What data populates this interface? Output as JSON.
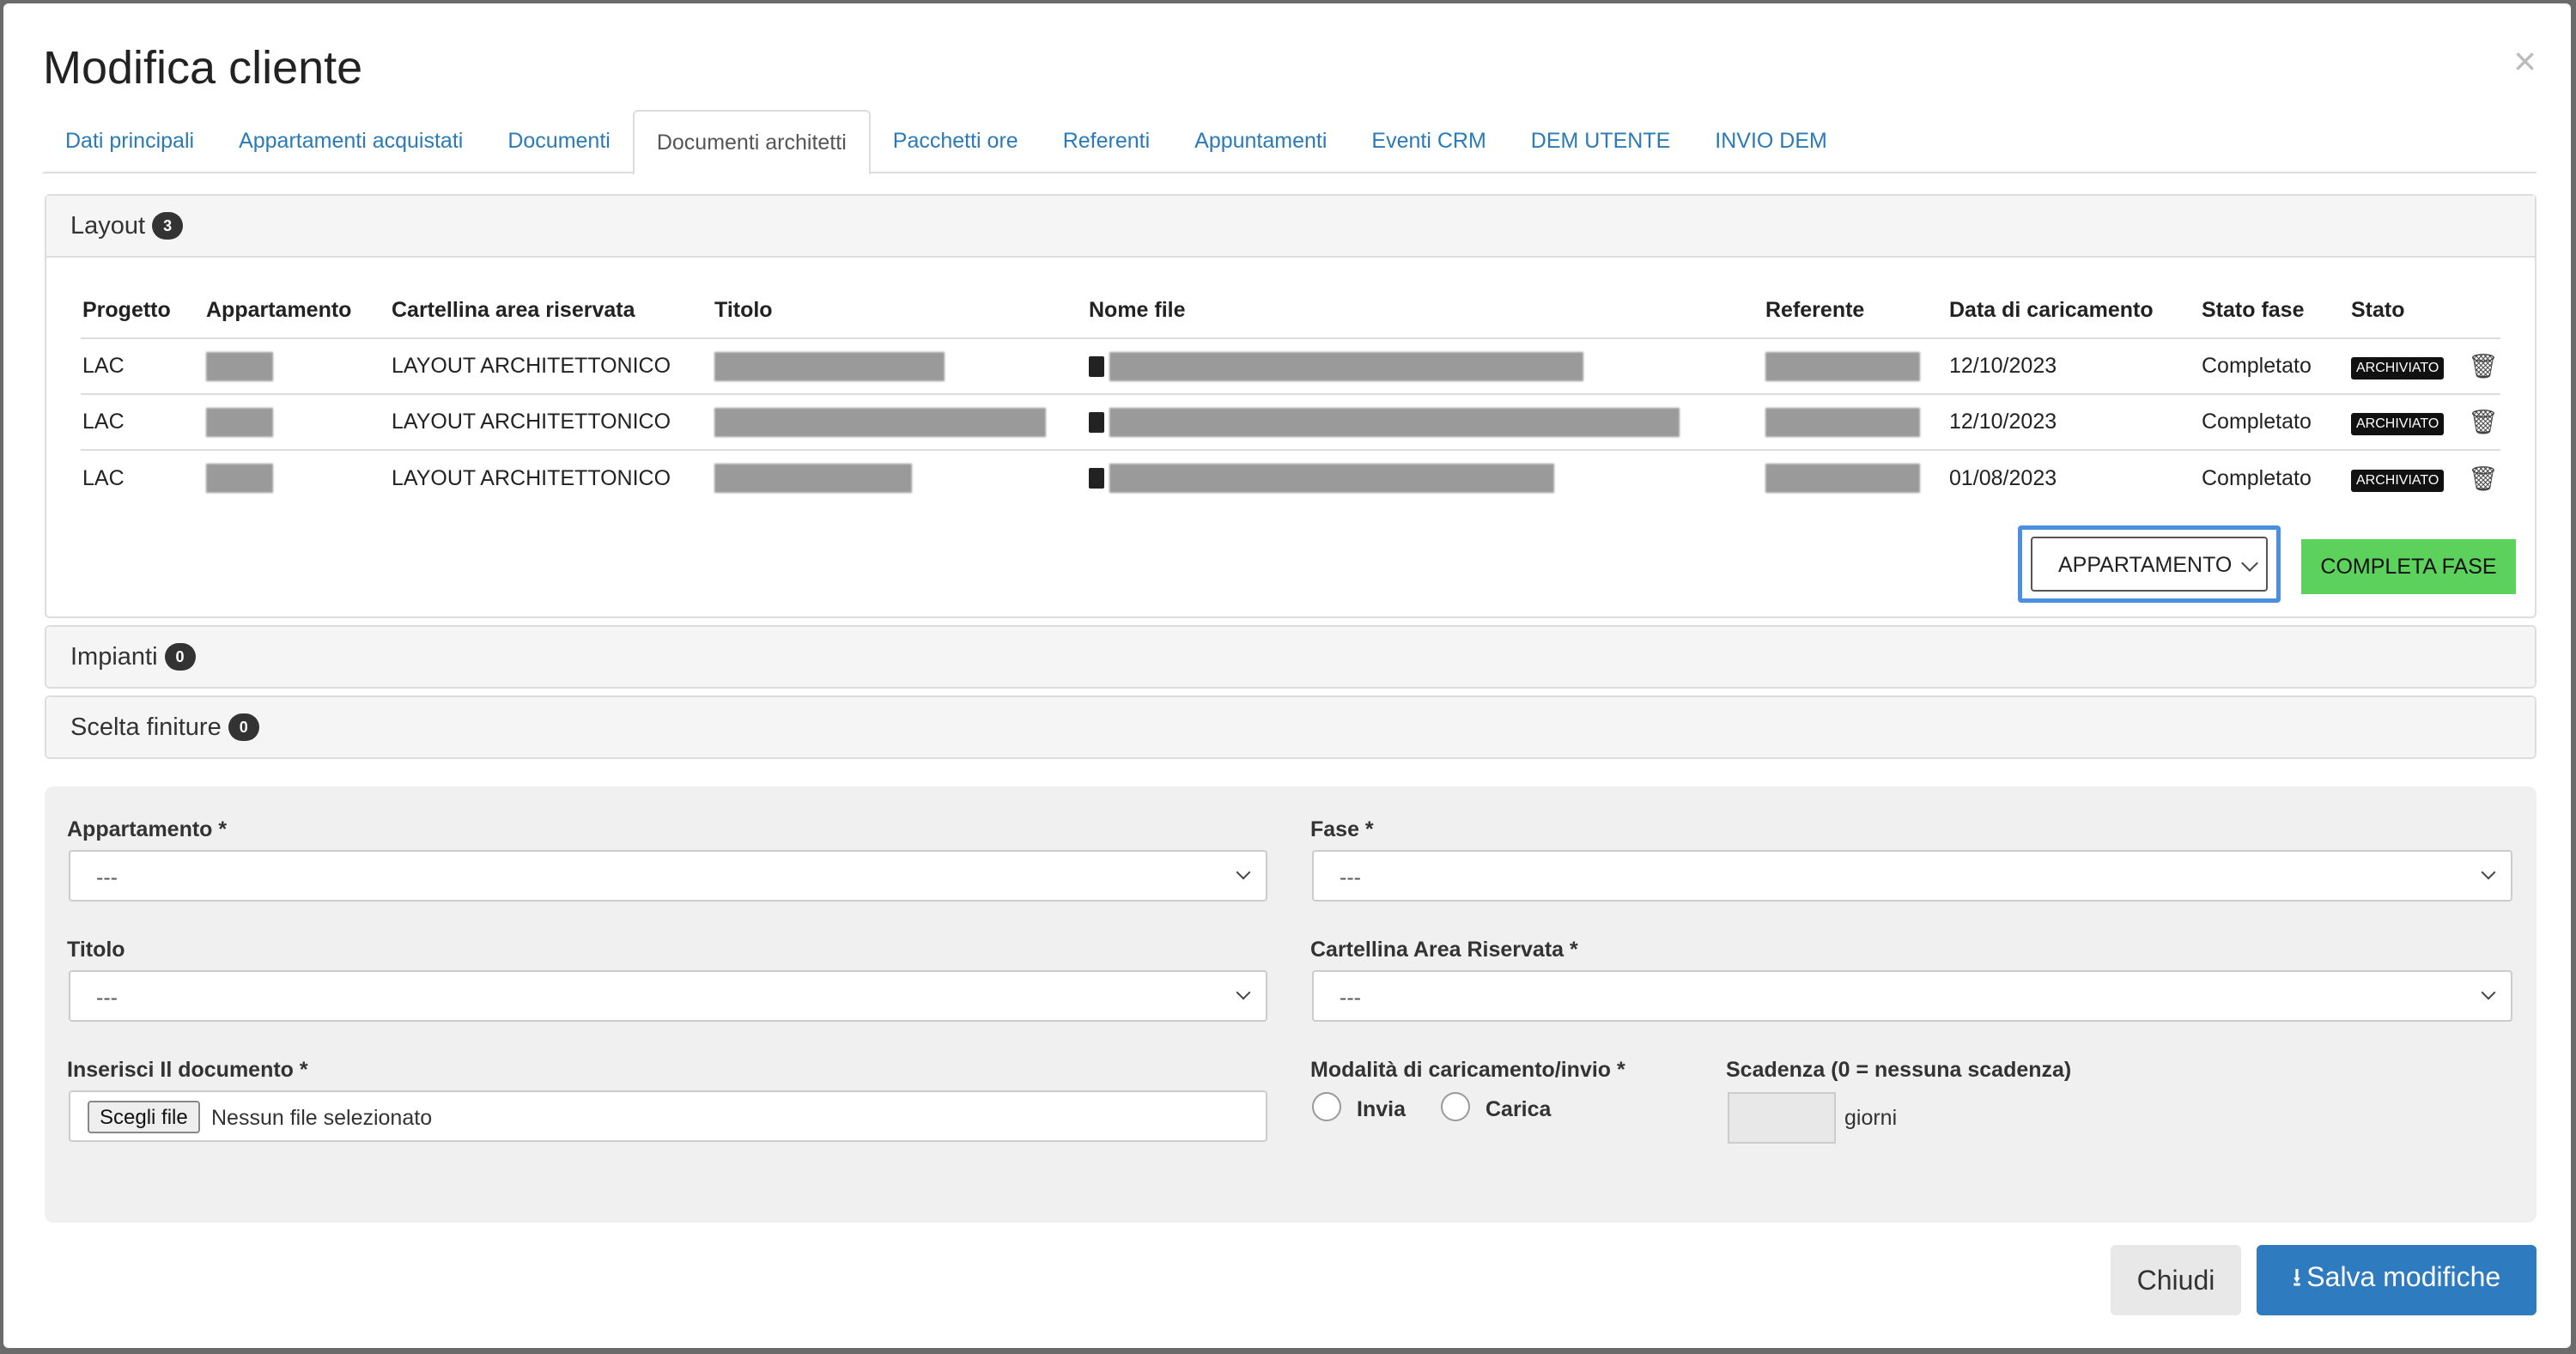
{
  "modal": {
    "title": "Modifica cliente",
    "close": "×"
  },
  "tabs": [
    {
      "label": "Dati principali"
    },
    {
      "label": "Appartamenti acquistati"
    },
    {
      "label": "Documenti"
    },
    {
      "label": "Documenti architetti",
      "active": true
    },
    {
      "label": "Pacchetti ore"
    },
    {
      "label": "Referenti"
    },
    {
      "label": "Appuntamenti"
    },
    {
      "label": "Eventi CRM"
    },
    {
      "label": "DEM UTENTE"
    },
    {
      "label": "INVIO DEM"
    }
  ],
  "layout_panel": {
    "title": "Layout",
    "count": "3",
    "columns": [
      "Progetto",
      "Appartamento",
      "Cartellina area riservata",
      "Titolo",
      "Nome file",
      "Referente",
      "Data di caricamento",
      "Stato fase",
      "Stato"
    ],
    "rows": [
      {
        "progetto": "LAC",
        "cartellina": "LAYOUT ARCHITETTONICO",
        "data": "12/10/2023",
        "stato_fase": "Completato",
        "stato": "ARCHIVIATO"
      },
      {
        "progetto": "LAC",
        "cartellina": "LAYOUT ARCHITETTONICO",
        "data": "12/10/2023",
        "stato_fase": "Completato",
        "stato": "ARCHIVIATO"
      },
      {
        "progetto": "LAC",
        "cartellina": "LAYOUT ARCHITETTONICO",
        "data": "01/08/2023",
        "stato_fase": "Completato",
        "stato": "ARCHIVIATO"
      }
    ],
    "select_value": "APPARTAMENTO",
    "complete_button": "COMPLETA FASE"
  },
  "impianti_panel": {
    "title": "Impianti",
    "count": "0"
  },
  "finiture_panel": {
    "title": "Scelta finiture",
    "count": "0"
  },
  "form": {
    "appartamento_label": "Appartamento *",
    "appartamento_value": "---",
    "fase_label": "Fase *",
    "fase_value": "---",
    "titolo_label": "Titolo",
    "titolo_value": "---",
    "cartellina_label": "Cartellina Area Riservata *",
    "cartellina_value": "---",
    "documento_label": "Inserisci Il documento *",
    "file_button": "Scegli file",
    "file_status": "Nessun file selezionato",
    "modalita_label": "Modalità di caricamento/invio *",
    "radio_invia": "Invia",
    "radio_carica": "Carica",
    "scadenza_label": "Scadenza (0 = nessuna scadenza)",
    "scadenza_unit": "giorni"
  },
  "footer": {
    "close_button": "Chiudi",
    "save_button": "Salva modifiche"
  }
}
